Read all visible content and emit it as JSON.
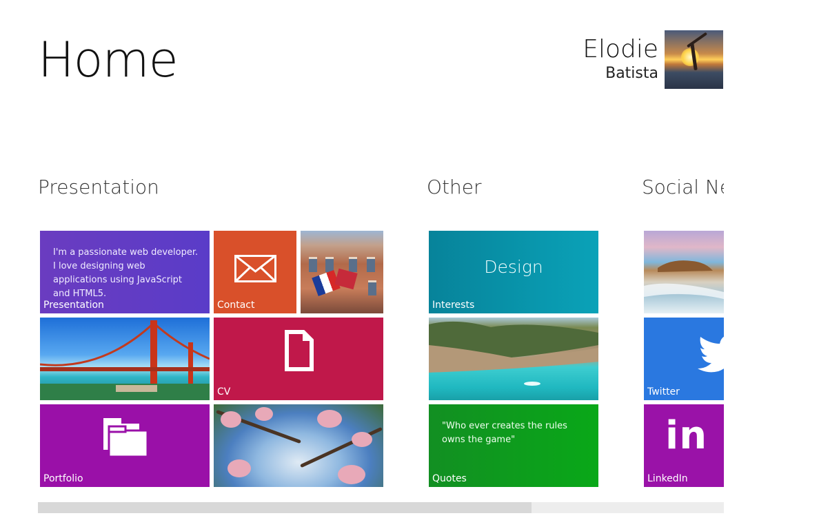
{
  "header": {
    "title": "Home"
  },
  "user": {
    "first_name": "Elodie",
    "last_name": "Batista"
  },
  "groups": [
    {
      "title": "Presentation"
    },
    {
      "title": "Other"
    },
    {
      "title": "Social Networks"
    }
  ],
  "tiles": {
    "presentation": {
      "label": "Presentation",
      "text": "I'm a passionate web developer. I love designing web applications using JavaScript and HTML5.",
      "color": "#6a3cc0"
    },
    "contact": {
      "label": "Contact",
      "icon": "envelope-icon",
      "color": "#d9502a"
    },
    "cv": {
      "label": "CV",
      "icon": "document-icon",
      "color": "#c0184a"
    },
    "portfolio": {
      "label": "Portfolio",
      "icon": "folder-icon",
      "color": "#9a10a8"
    },
    "interests": {
      "label": "Interests",
      "text": "Design",
      "color": "#0a93a8"
    },
    "quotes": {
      "label": "Quotes",
      "text": "\"Who ever creates the rules owns the game\"",
      "color": "#0e9a1c"
    },
    "twitter": {
      "label": "Twitter",
      "icon": "twitter-bird-icon",
      "color": "#2a78e0"
    },
    "linkedin": {
      "label": "LinkedIn",
      "logo_text": "in",
      "color": "#9a12a8"
    }
  },
  "scrollbar": {
    "position_fraction": 0.72
  }
}
